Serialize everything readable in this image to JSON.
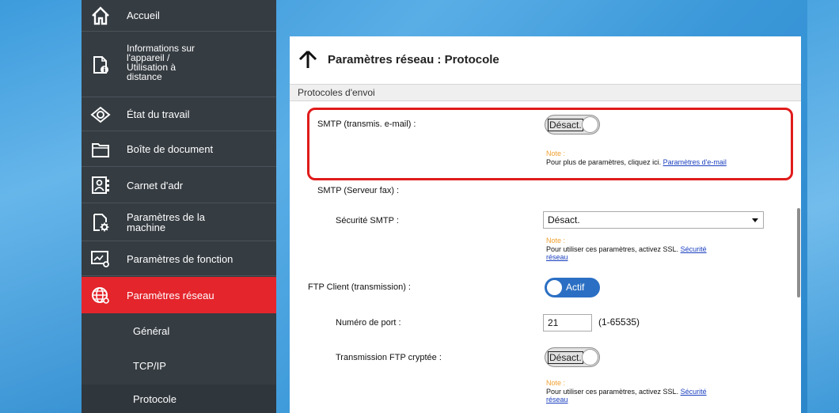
{
  "sidebar": {
    "items": [
      {
        "label": "Accueil",
        "icon": "home-icon"
      },
      {
        "label": "Informations sur\nl'appareil /\nUtilisation à\ndistance",
        "icon": "device-info-icon"
      },
      {
        "label": "État du travail",
        "icon": "eye-icon"
      },
      {
        "label": "Boîte de document",
        "icon": "folder-icon"
      },
      {
        "label": "Carnet d'adr",
        "icon": "address-book-icon"
      },
      {
        "label": "Paramètres de la\nmachine",
        "icon": "machine-settings-icon"
      },
      {
        "label": "Paramètres de fonction",
        "icon": "function-settings-icon"
      },
      {
        "label": "Paramètres réseau",
        "icon": "network-globe-icon"
      }
    ],
    "subitems": [
      {
        "label": "Général"
      },
      {
        "label": "TCP/IP"
      },
      {
        "label": "Protocole"
      }
    ]
  },
  "panel": {
    "title": "Paramètres réseau : Protocole",
    "section": "Protocoles d'envoi"
  },
  "settings": {
    "smtp_email": {
      "label": "SMTP (transmis. e-mail) :",
      "toggle": "Désact.",
      "note_label": "Note :",
      "note_text": "Pour plus de paramètres, cliquez ici. ",
      "note_link": "Paramètres d'e-mail"
    },
    "smtp_fax": {
      "label": "SMTP (Serveur fax) :"
    },
    "smtp_security": {
      "label": "Sécurité SMTP :",
      "value": "Désact.",
      "note_label": "Note :",
      "note_text": "Pour utiliser ces paramètres, activez SSL. ",
      "note_link_1": "Sécurité",
      "note_link_2": "réseau"
    },
    "ftp_client": {
      "label": "FTP Client (transmission) :",
      "toggle": "Actif"
    },
    "port": {
      "label": "Numéro de port :",
      "value": "21",
      "range": "(1-65535)"
    },
    "ftp_encrypted": {
      "label": "Transmission FTP cryptée :",
      "toggle": "Désact.",
      "note_label": "Note :",
      "note_text": "Pour utiliser ces paramètres, activez SSL. ",
      "note_link_1": "Sécurité",
      "note_link_2": "réseau"
    }
  },
  "colors": {
    "accent_red": "#e4252c",
    "toggle_on": "#2b6fc4",
    "sidebar_bg": "#353c42",
    "note_orange": "#f0a030"
  }
}
